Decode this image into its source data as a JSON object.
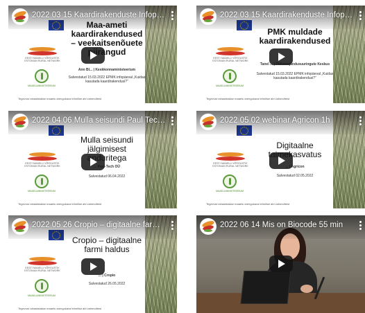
{
  "videos": [
    {
      "title": "2022 03 15 Kaardirakenduste Infopaev",
      "heading": "Maa-ameti kaardirakendused – veekaitsenõuete piirangud",
      "presenter": "Ann Bl... | Keskkonnaministeerium",
      "date_line": "Salvestatud 15.03.2022 EPMK infopäeval „Kuidas kasutada kaardirakendusi?“"
    },
    {
      "title": "2022 03 15 Kaardirakenduste Infopaev...",
      "heading": "PMK muldade kaardirakendused",
      "presenter": "Tanel ... | Põllumajandusuuringute Keskus",
      "date_line": "Salvestatud 15.03.2022 EPMK infopäeval „Kuidas kasutada kaardirakendusi?“"
    },
    {
      "title": "2022 04 06 Mulla seisundi Paul Tech 3...",
      "heading": "Mulla seisundi jälgimisest anduritega",
      "presenter": "... Paul-Tech OÜ",
      "date_line": "Salvestatud 06.04.2022"
    },
    {
      "title": "2022 05 02 webinar Agricon 1h",
      "heading": "Digitaalne taimekasvatus",
      "presenter": "... | Agricon",
      "date_line": "Salvestatud 02.05.2022"
    },
    {
      "title": "2022 05 26 Cropio – digitaalne farmi h...",
      "heading": "Cropio – digitaalne farmi haldus",
      "presenter": "... | Cropio",
      "date_line": "Salvestatud 26.05.2022"
    },
    {
      "title": "2022 06 14 Mis on Biocode 55 min"
    }
  ],
  "logos": {
    "network": "EESTI MAAELU VÕRGUSTIK",
    "network_en": "ESTONIAN RURAL NETWORK",
    "ministry": "MAAELUMINISTEERIUM"
  },
  "footnote": "Tegevust rahastatakse maaelu arengukava tehnilise abi vahenditest"
}
